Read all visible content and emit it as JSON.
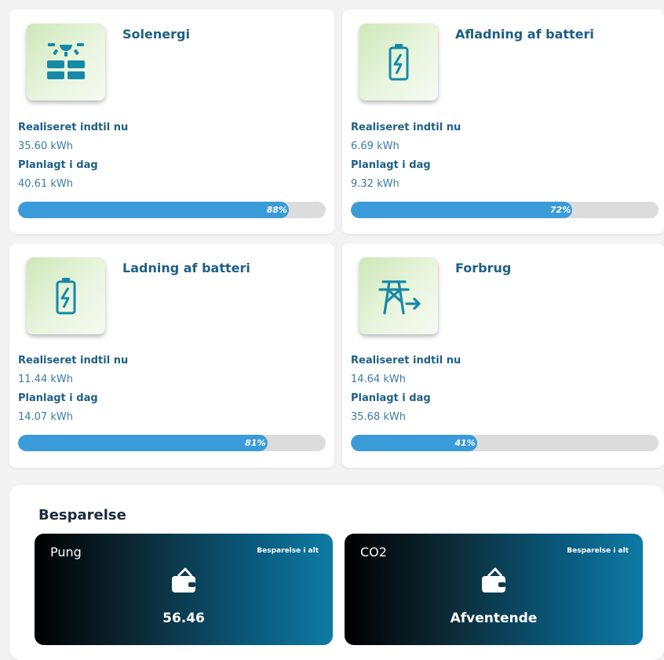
{
  "colors": {
    "accent": "#3a9bd8",
    "text": "#1e5f85",
    "icon_bg": "#cde8b8",
    "bar_bg": "#dcdcdc"
  },
  "cards": [
    {
      "title": "Solenergi",
      "icon": "solar-panel-icon",
      "realized_label": "Realiseret indtil nu",
      "realized_value": "35.60 kWh",
      "planned_label": "Planlagt i dag",
      "planned_value": "40.61 kWh",
      "percent_label": "88%",
      "percent": 88
    },
    {
      "title": "Afladning af batteri",
      "icon": "battery-charging-icon",
      "realized_label": "Realiseret indtil nu",
      "realized_value": "6.69 kWh",
      "planned_label": "Planlagt i dag",
      "planned_value": "9.32 kWh",
      "percent_label": "72%",
      "percent": 72
    },
    {
      "title": "Ladning af batteri",
      "icon": "battery-charging-icon",
      "realized_label": "Realiseret indtil nu",
      "realized_value": "11.44 kWh",
      "planned_label": "Planlagt i dag",
      "planned_value": "14.07 kWh",
      "percent_label": "81%",
      "percent": 81
    },
    {
      "title": "Forbrug",
      "icon": "power-tower-arrow-icon",
      "realized_label": "Realiseret indtil nu",
      "realized_value": "14.64 kWh",
      "planned_label": "Planlagt i dag",
      "planned_value": "35.68 kWh",
      "percent_label": "41%",
      "percent": 41
    }
  ],
  "savings": {
    "title": "Besparelse",
    "tiles": [
      {
        "name": "Pung",
        "subtitle": "Besparelse i alt",
        "icon": "wallet-icon",
        "value": "56.46"
      },
      {
        "name": "CO2",
        "subtitle": "Besparelse i alt",
        "icon": "wallet-icon",
        "value": "Afventende"
      }
    ]
  }
}
